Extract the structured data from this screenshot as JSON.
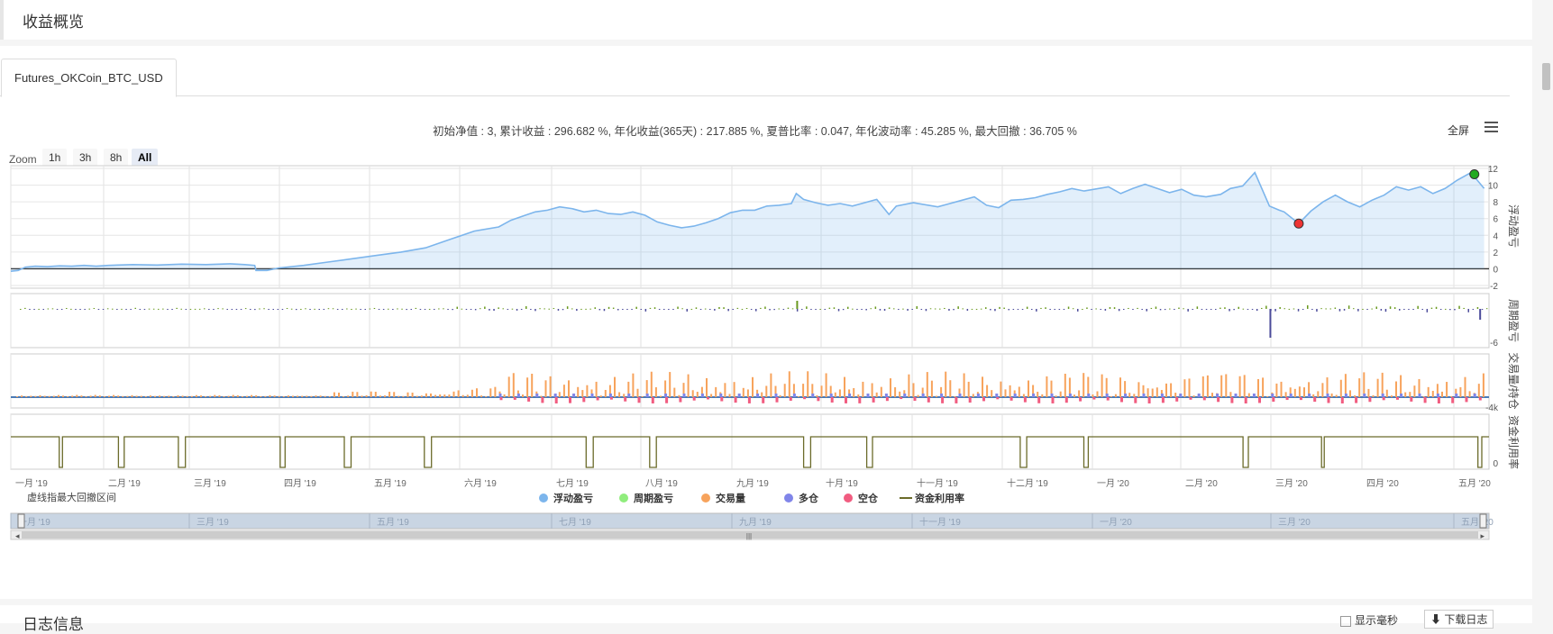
{
  "page": {
    "section_title": "收益概览",
    "tab_label": "Futures_OKCoin_BTC_USD",
    "stats_line": "初始净值 : 3, 累计收益 : 296.682 %, 年化收益(365天) : 217.885 %, 夏普比率 : 0.047, 年化波动率 : 45.285 %, 最大回撤 : 36.705 %",
    "fullscreen_label": "全屏",
    "zoom": {
      "label": "Zoom",
      "buttons": [
        "1h",
        "3h",
        "8h",
        "All"
      ],
      "active": "All"
    },
    "drawdown_note": "虚线指最大回撤区间",
    "log_title": "日志信息",
    "log_option": "显示毫秒",
    "download_label": "下载日志"
  },
  "chart_data": {
    "type": "line",
    "x_ticks": [
      "一月 '19",
      "二月 '19",
      "三月 '19",
      "四月 '19",
      "五月 '19",
      "六月 '19",
      "七月 '19",
      "八月 '19",
      "九月 '19",
      "十月 '19",
      "十一月 '19",
      "十二月 '19",
      "一月 '20",
      "二月 '20",
      "三月 '20",
      "四月 '20",
      "五月 '20"
    ],
    "navigator_ticks": [
      "一月 '19",
      "三月 '19",
      "五月 '19",
      "七月 '19",
      "九月 '19",
      "十一月 '19",
      "一月 '20",
      "三月 '20",
      "五月 '20"
    ],
    "legend": [
      {
        "name": "浮动盈亏",
        "color": "#7cb5ec"
      },
      {
        "name": "周期盈亏",
        "color": "#90ed7d"
      },
      {
        "name": "交易量",
        "color": "#f7a35c"
      },
      {
        "name": "多仓",
        "color": "#8085e9"
      },
      {
        "name": "空仓",
        "color": "#f15c80"
      },
      {
        "name": "资金利用率",
        "color": "#6b6b2a"
      }
    ],
    "panes": [
      {
        "name": "浮动盈亏",
        "y_ticks": [
          "12",
          "10",
          "8",
          "6",
          "4",
          "2",
          "0",
          "-2"
        ],
        "ylim": [
          -2,
          12
        ]
      },
      {
        "name": "周期盈亏",
        "y_ticks": [
          "-6"
        ]
      },
      {
        "name": "交易量/持仓",
        "y_ticks": [
          "-4k"
        ]
      },
      {
        "name": "资金利用率",
        "y_ticks": [
          "0"
        ]
      }
    ],
    "profit_series": {
      "name": "浮动盈亏",
      "points": [
        [
          0.0,
          -0.3
        ],
        [
          0.3,
          -0.2
        ],
        [
          0.6,
          0.2
        ],
        [
          1.0,
          0.3
        ],
        [
          1.5,
          0.25
        ],
        [
          2.0,
          0.35
        ],
        [
          2.5,
          0.3
        ],
        [
          3.0,
          0.4
        ],
        [
          3.5,
          0.3
        ],
        [
          4.0,
          0.4
        ],
        [
          5.0,
          0.5
        ],
        [
          6.0,
          0.45
        ],
        [
          7.0,
          0.55
        ],
        [
          8.0,
          0.5
        ],
        [
          9.0,
          0.6
        ],
        [
          9.6,
          0.5
        ],
        [
          10.0,
          0.4
        ],
        [
          10.05,
          -0.2
        ],
        [
          10.5,
          -0.2
        ],
        [
          11.0,
          0.1
        ],
        [
          12.0,
          0.4
        ],
        [
          13.0,
          0.8
        ],
        [
          14.0,
          1.2
        ],
        [
          15.0,
          1.6
        ],
        [
          16.0,
          2.0
        ],
        [
          17.0,
          2.5
        ],
        [
          18.0,
          3.5
        ],
        [
          19.0,
          4.5
        ],
        [
          20.0,
          5.0
        ],
        [
          20.5,
          5.8
        ],
        [
          21.0,
          6.3
        ],
        [
          21.5,
          6.8
        ],
        [
          22.0,
          7.0
        ],
        [
          22.5,
          7.4
        ],
        [
          23.0,
          7.2
        ],
        [
          23.5,
          6.8
        ],
        [
          24.0,
          7.0
        ],
        [
          24.5,
          6.6
        ],
        [
          25.0,
          6.5
        ],
        [
          25.5,
          6.8
        ],
        [
          26.0,
          6.4
        ],
        [
          26.5,
          5.6
        ],
        [
          27.0,
          5.2
        ],
        [
          27.5,
          4.9
        ],
        [
          28.0,
          5.1
        ],
        [
          28.5,
          5.5
        ],
        [
          29.0,
          6.0
        ],
        [
          29.5,
          6.7
        ],
        [
          30.0,
          7.0
        ],
        [
          30.5,
          7.0
        ],
        [
          31.0,
          7.5
        ],
        [
          31.5,
          7.6
        ],
        [
          32.0,
          7.8
        ],
        [
          32.2,
          9.0
        ],
        [
          32.5,
          8.3
        ],
        [
          33.0,
          7.9
        ],
        [
          33.5,
          7.6
        ],
        [
          34.0,
          7.8
        ],
        [
          34.5,
          7.5
        ],
        [
          35.0,
          7.9
        ],
        [
          35.5,
          8.3
        ],
        [
          36.0,
          6.5
        ],
        [
          36.3,
          7.5
        ],
        [
          37.0,
          7.9
        ],
        [
          38.0,
          7.4
        ],
        [
          38.5,
          7.8
        ],
        [
          39.0,
          8.2
        ],
        [
          39.5,
          8.6
        ],
        [
          40.0,
          7.6
        ],
        [
          40.5,
          7.3
        ],
        [
          41.0,
          8.2
        ],
        [
          41.5,
          8.3
        ],
        [
          42.0,
          8.5
        ],
        [
          42.5,
          8.9
        ],
        [
          43.0,
          9.2
        ],
        [
          43.5,
          9.6
        ],
        [
          44.0,
          9.3
        ],
        [
          45.0,
          9.8
        ],
        [
          45.5,
          9.0
        ],
        [
          46.0,
          9.6
        ],
        [
          46.5,
          10.1
        ],
        [
          47.0,
          9.6
        ],
        [
          47.5,
          9.1
        ],
        [
          48.0,
          9.5
        ],
        [
          48.5,
          8.8
        ],
        [
          49.0,
          8.6
        ],
        [
          49.6,
          8.9
        ],
        [
          50.0,
          9.6
        ],
        [
          50.5,
          9.9
        ],
        [
          51.0,
          11.5
        ],
        [
          51.6,
          7.5
        ],
        [
          52.0,
          7.0
        ],
        [
          52.2,
          6.8
        ],
        [
          52.8,
          5.4
        ],
        [
          53.3,
          6.9
        ],
        [
          53.8,
          8.0
        ],
        [
          54.3,
          8.8
        ],
        [
          54.8,
          8.0
        ],
        [
          55.3,
          7.4
        ],
        [
          55.8,
          8.2
        ],
        [
          56.3,
          8.8
        ],
        [
          56.8,
          9.8
        ],
        [
          57.3,
          9.4
        ],
        [
          57.8,
          9.8
        ],
        [
          58.3,
          9.0
        ],
        [
          58.8,
          9.6
        ],
        [
          59.3,
          10.6
        ],
        [
          59.8,
          11.4
        ],
        [
          60.0,
          11.0
        ],
        [
          60.4,
          9.6
        ]
      ]
    },
    "markers": [
      {
        "x": 52.8,
        "y": 5.4,
        "color": "#e33"
      },
      {
        "x": 60.0,
        "y": 11.3,
        "color": "#2a2"
      }
    ],
    "x_range_months": [
      0,
      60.6
    ]
  }
}
